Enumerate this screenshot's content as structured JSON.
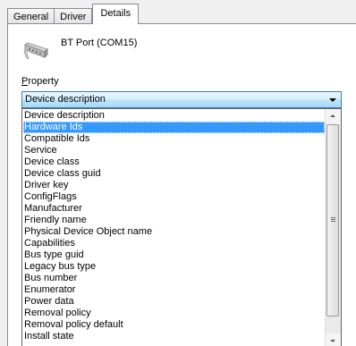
{
  "tabs": [
    {
      "label": "General"
    },
    {
      "label": "Driver"
    },
    {
      "label": "Details"
    }
  ],
  "device": {
    "name": "BT Port (COM15)",
    "icon": "serial-port-icon"
  },
  "property": {
    "label": "Property",
    "label_first": "P",
    "label_rest": "roperty",
    "selected_value": "Device description"
  },
  "dropdown": {
    "items": [
      "Device description",
      "Hardware Ids",
      "Compatible Ids",
      "Service",
      "Device class",
      "Device class guid",
      "Driver key",
      "ConfigFlags",
      "Manufacturer",
      "Friendly name",
      "Physical Device Object name",
      "Capabilities",
      "Bus type guid",
      "Legacy bus type",
      "Bus number",
      "Enumerator",
      "Power data",
      "Removal policy",
      "Removal policy default",
      "Install state"
    ],
    "highlighted_item": "Hardware Ids"
  },
  "colors": {
    "selection": "#3399ff",
    "combo_border": "#3c7fb1"
  }
}
